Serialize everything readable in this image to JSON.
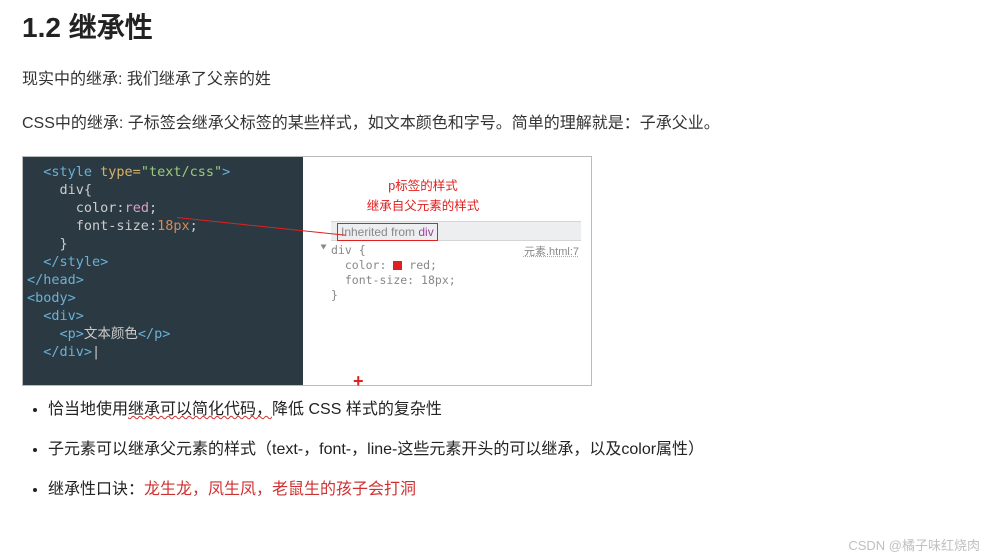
{
  "heading": "1.2 继承性",
  "para1": "现实中的继承: 我们继承了父亲的姓",
  "para2": "CSS中的继承: 子标签会继承父标签的某些样式，如文本颜色和字号。简单的理解就是：子承父业。",
  "code": {
    "l1a": "<style ",
    "l1b": "type=",
    "l1c": "\"text/css\"",
    "l1d": ">",
    "l2": "div{",
    "l3a": "color",
    "l3b": ":",
    "l3c": "red",
    "l3d": ";",
    "l4a": "font-size",
    "l4b": ":",
    "l4c": "18px",
    "l4d": ";",
    "l5": "}",
    "l6": "</style>",
    "l7": "</head>",
    "l8": "<body>",
    "l9": "<div>",
    "l10a": "<p>",
    "l10b": "文本颜色",
    "l10c": "</p>",
    "l11": "</div>"
  },
  "anno1": "p标签的样式",
  "anno2": "继承自父元素的样式",
  "inheritFrom": {
    "kw": "Inherited from ",
    "el": "div"
  },
  "rule": {
    "sel": "div {",
    "p1k": "color:",
    "p1v": "red;",
    "p2k": "font-size:",
    "p2v": "18px;",
    "close": "}"
  },
  "srcLink": "元素.html:7",
  "cross": "+",
  "bullets": {
    "b1a": "恰当地使用",
    "b1w": "继承可以简化代码，",
    "b1b": "降低 CSS 样式的复杂性",
    "b2": "子元素可以继承父元素的样式（text-，font-，line-这些元素开头的可以继承，以及color属性）",
    "b3a": "继承性口诀：",
    "b3r": "龙生龙，凤生凤，老鼠生的孩子会打洞"
  },
  "watermark": "CSDN @橘子味红烧肉"
}
